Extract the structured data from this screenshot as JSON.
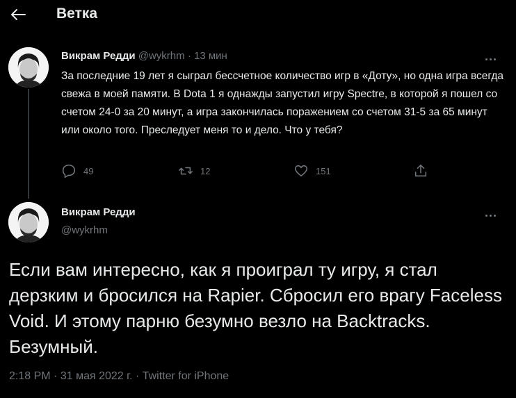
{
  "header": {
    "title": "Ветка"
  },
  "tweets": [
    {
      "author_name": "Викрам Редди",
      "author_handle": "@wykrhm",
      "separator": "·",
      "time": "13 мин",
      "text": "За последние 19 лет я сыграл бессчетное количество игр в «Доту», но одна игра всегда свежа в моей памяти. В Dota 1 я однажды запустил игру Spectre, в которой я пошел со счетом 24-0 за 20 минут, а игра закончилась поражением со счетом 31-5 за 65 минут или около того. Преследует меня то и дело. Что у тебя?",
      "replies": "49",
      "retweets": "12",
      "likes": "151"
    }
  ],
  "main_tweet": {
    "author_name": "Викрам Редди",
    "author_handle": "@wykrhm",
    "text": "Если вам интересно, как я проиграл ту игру, я стал дерзким и бросился на Rapier. Сбросил его врагу Faceless Void. И этому парню безумно везло на Backtracks. Безумный.",
    "time": "2:18 PM",
    "date": "31 мая 2022 г.",
    "source": "Twitter for iPhone",
    "separator": "·"
  },
  "colors": {
    "background": "#000000",
    "text": "#e7e9ea",
    "secondary": "#71767b",
    "divider": "#333639"
  },
  "icons": [
    "back-arrow-icon",
    "more-icon",
    "reply-icon",
    "retweet-icon",
    "like-icon",
    "share-icon"
  ]
}
